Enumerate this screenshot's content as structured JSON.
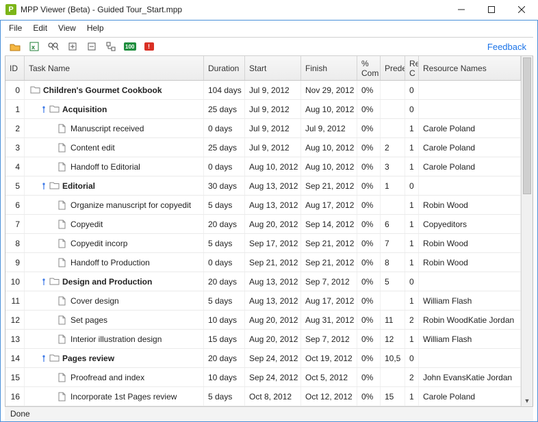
{
  "window": {
    "appIconLetter": "P",
    "title": "MPP Viewer (Beta) - Guided Tour_Start.mpp"
  },
  "menu": {
    "items": [
      "File",
      "Edit",
      "View",
      "Help"
    ]
  },
  "toolbar": {
    "feedback": "Feedback"
  },
  "columns": {
    "id": "ID",
    "name": "Task Name",
    "dur": "Duration",
    "start": "Start",
    "fin": "Finish",
    "pcom1": "%",
    "pcom2": "Com",
    "pred": "Prede",
    "rc1": "Re",
    "rc2": "C",
    "res": "Resource Names"
  },
  "rows": [
    {
      "id": "0",
      "indent": 0,
      "summary": true,
      "link": false,
      "name": "Children's Gourmet Cookbook",
      "dur": "104 days",
      "start": "Jul 9, 2012",
      "fin": "Nov 29, 2012",
      "pcom": "0%",
      "pred": "",
      "rc": "0",
      "res": ""
    },
    {
      "id": "1",
      "indent": 1,
      "summary": true,
      "link": true,
      "name": "Acquisition",
      "dur": "25 days",
      "start": "Jul 9, 2012",
      "fin": "Aug 10, 2012",
      "pcom": "0%",
      "pred": "",
      "rc": "0",
      "res": ""
    },
    {
      "id": "2",
      "indent": 2,
      "summary": false,
      "link": false,
      "name": "Manuscript received",
      "dur": "0 days",
      "start": "Jul 9, 2012",
      "fin": "Jul 9, 2012",
      "pcom": "0%",
      "pred": "",
      "rc": "1",
      "res": "Carole Poland"
    },
    {
      "id": "3",
      "indent": 2,
      "summary": false,
      "link": false,
      "name": "Content edit",
      "dur": "25 days",
      "start": "Jul 9, 2012",
      "fin": "Aug 10, 2012",
      "pcom": "0%",
      "pred": "2",
      "rc": "1",
      "res": "Carole Poland"
    },
    {
      "id": "4",
      "indent": 2,
      "summary": false,
      "link": false,
      "name": "Handoff to Editorial",
      "dur": "0 days",
      "start": "Aug 10, 2012",
      "fin": "Aug 10, 2012",
      "pcom": "0%",
      "pred": "3",
      "rc": "1",
      "res": "Carole Poland"
    },
    {
      "id": "5",
      "indent": 1,
      "summary": true,
      "link": true,
      "name": "Editorial",
      "dur": "30 days",
      "start": "Aug 13, 2012",
      "fin": "Sep 21, 2012",
      "pcom": "0%",
      "pred": "1",
      "rc": "0",
      "res": ""
    },
    {
      "id": "6",
      "indent": 2,
      "summary": false,
      "link": false,
      "name": "Organize manuscript for copyedit",
      "dur": "5 days",
      "start": "Aug 13, 2012",
      "fin": "Aug 17, 2012",
      "pcom": "0%",
      "pred": "",
      "rc": "1",
      "res": "Robin Wood"
    },
    {
      "id": "7",
      "indent": 2,
      "summary": false,
      "link": false,
      "name": "Copyedit",
      "dur": "20 days",
      "start": "Aug 20, 2012",
      "fin": "Sep 14, 2012",
      "pcom": "0%",
      "pred": "6",
      "rc": "1",
      "res": "Copyeditors"
    },
    {
      "id": "8",
      "indent": 2,
      "summary": false,
      "link": false,
      "name": "Copyedit incorp",
      "dur": "5 days",
      "start": "Sep 17, 2012",
      "fin": "Sep 21, 2012",
      "pcom": "0%",
      "pred": "7",
      "rc": "1",
      "res": "Robin Wood"
    },
    {
      "id": "9",
      "indent": 2,
      "summary": false,
      "link": false,
      "name": "Handoff to Production",
      "dur": "0 days",
      "start": "Sep 21, 2012",
      "fin": "Sep 21, 2012",
      "pcom": "0%",
      "pred": "8",
      "rc": "1",
      "res": "Robin Wood"
    },
    {
      "id": "10",
      "indent": 1,
      "summary": true,
      "link": true,
      "name": "Design and Production",
      "dur": "20 days",
      "start": "Aug 13, 2012",
      "fin": "Sep 7, 2012",
      "pcom": "0%",
      "pred": "5",
      "rc": "0",
      "res": ""
    },
    {
      "id": "11",
      "indent": 2,
      "summary": false,
      "link": false,
      "name": "Cover design",
      "dur": "5 days",
      "start": "Aug 13, 2012",
      "fin": "Aug 17, 2012",
      "pcom": "0%",
      "pred": "",
      "rc": "1",
      "res": "William Flash"
    },
    {
      "id": "12",
      "indent": 2,
      "summary": false,
      "link": false,
      "name": "Set pages",
      "dur": "10 days",
      "start": "Aug 20, 2012",
      "fin": "Aug 31, 2012",
      "pcom": "0%",
      "pred": "11",
      "rc": "2",
      "res": "Robin WoodKatie Jordan"
    },
    {
      "id": "13",
      "indent": 2,
      "summary": false,
      "link": false,
      "name": "Interior illustration design",
      "dur": "15 days",
      "start": "Aug 20, 2012",
      "fin": "Sep 7, 2012",
      "pcom": "0%",
      "pred": "12",
      "rc": "1",
      "res": "William Flash"
    },
    {
      "id": "14",
      "indent": 1,
      "summary": true,
      "link": true,
      "name": "Pages review",
      "dur": "20 days",
      "start": "Sep 24, 2012",
      "fin": "Oct 19, 2012",
      "pcom": "0%",
      "pred": "10,5",
      "rc": "0",
      "res": ""
    },
    {
      "id": "15",
      "indent": 2,
      "summary": false,
      "link": false,
      "name": "Proofread and index",
      "dur": "10 days",
      "start": "Sep 24, 2012",
      "fin": "Oct 5, 2012",
      "pcom": "0%",
      "pred": "",
      "rc": "2",
      "res": "John EvansKatie Jordan"
    },
    {
      "id": "16",
      "indent": 2,
      "summary": false,
      "link": false,
      "name": "Incorporate 1st Pages review",
      "dur": "5 days",
      "start": "Oct 8, 2012",
      "fin": "Oct 12, 2012",
      "pcom": "0%",
      "pred": "15",
      "rc": "1",
      "res": "Carole Poland"
    }
  ],
  "status": "Done"
}
